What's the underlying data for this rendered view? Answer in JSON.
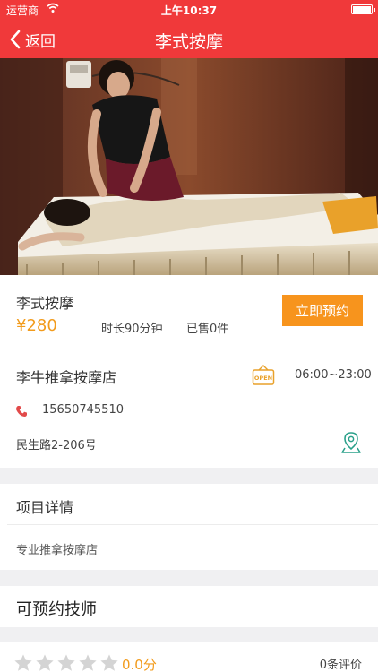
{
  "status_bar": {
    "carrier": "运营商",
    "time": "上午10:37"
  },
  "nav": {
    "back_label": "返回",
    "title": "李式按摩"
  },
  "product": {
    "name": "李式按摩",
    "price": "¥280",
    "duration": "时长90分钟",
    "sold": "已售0件",
    "book_button": "立即预约"
  },
  "store": {
    "name": "李牛推拿按摩店",
    "open_badge": "OPEN",
    "hours": "06:00~23:00",
    "phone": "15650745510",
    "address": "民生路2-206号"
  },
  "detail": {
    "title": "项目详情",
    "text": "专业推拿按摩店"
  },
  "technicians": {
    "title": "可预约技师"
  },
  "review": {
    "score": "0.0分",
    "count": "0条评价",
    "stars_filled": 0,
    "stars_total": 5
  },
  "colors": {
    "accent": "#f0393a",
    "orange": "#f7941d",
    "price": "#f29b1c",
    "map_icon": "#2aa08a"
  },
  "icons": [
    "back-chevron-icon",
    "wifi-icon",
    "battery-icon",
    "open-sign-icon",
    "phone-icon",
    "map-pin-icon",
    "star-icon"
  ]
}
